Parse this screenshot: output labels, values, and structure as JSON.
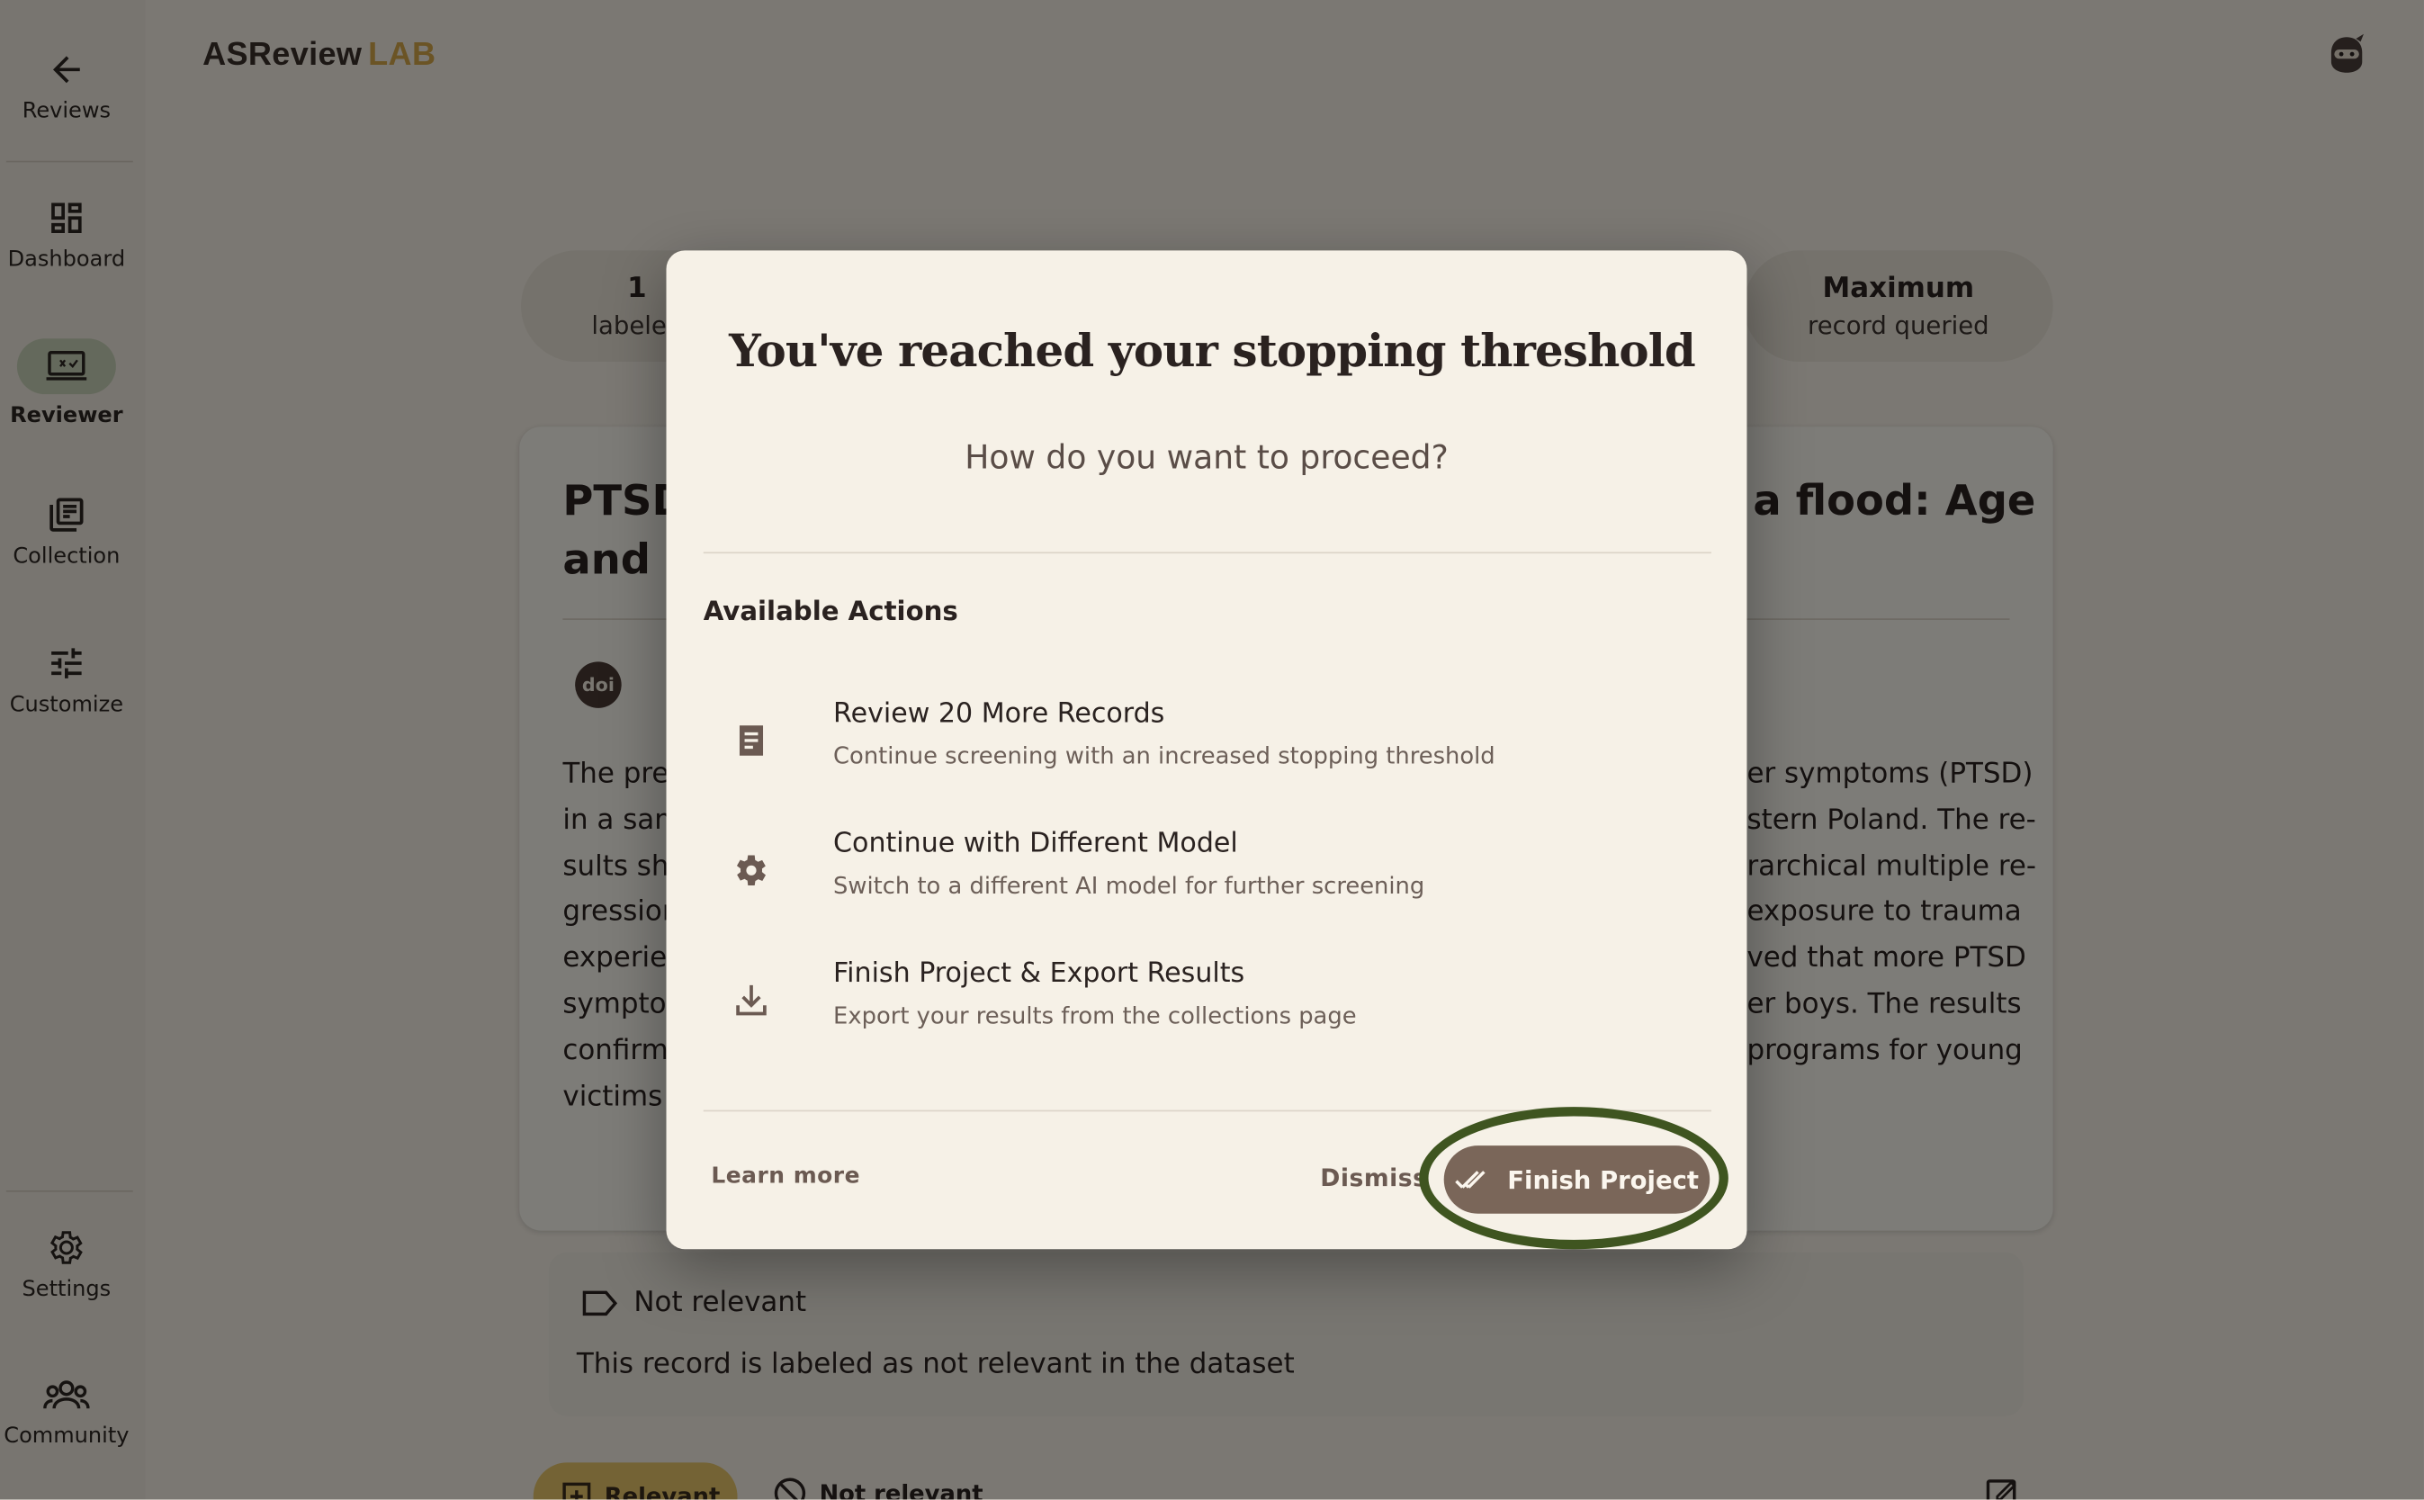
{
  "app": {
    "brand_main": "ASReview",
    "brand_accent": "LAB"
  },
  "sidebar": {
    "back": {
      "label": "Reviews",
      "icon": "arrow-back-icon"
    },
    "items": [
      {
        "label": "Dashboard",
        "icon": "dashboard-icon"
      },
      {
        "label": "Reviewer",
        "icon": "reviewer-icon",
        "active": true
      },
      {
        "label": "Collection",
        "icon": "collection-icon"
      },
      {
        "label": "Customize",
        "icon": "tune-icon"
      }
    ],
    "bottom": [
      {
        "label": "Settings",
        "icon": "gear-icon"
      },
      {
        "label": "Community",
        "icon": "community-icon"
      }
    ]
  },
  "stats": {
    "labeled_value": "1",
    "labeled_label": "labeled",
    "max_value": "Maximum",
    "max_label": "record queried"
  },
  "record": {
    "title_left_1": "PTSD",
    "title_left_2": "and g",
    "title_right": "a flood: Age",
    "doi_badge": "doi",
    "abstract_left": [
      "The pres",
      "in a sam",
      "sults sh",
      "gressior",
      "experien",
      "symptor",
      "confirm",
      "victims"
    ],
    "abstract_right": [
      "er symptoms (PTSD)",
      "stern Poland. The re-",
      "rarchical multiple re-",
      "exposure to trauma",
      "ved that more PTSD",
      "er boys. The results",
      "programs for young",
      ""
    ]
  },
  "label_panel": {
    "label": "Not relevant",
    "description": "This record is labeled as not relevant in the dataset"
  },
  "decision": {
    "relevant": "Relevant",
    "not_relevant": "Not relevant"
  },
  "dialog": {
    "title": "You've reached your stopping threshold",
    "subtitle": "How do you want to proceed?",
    "section": "Available Actions",
    "actions": [
      {
        "title": "Review 20 More Records",
        "desc": "Continue screening with an increased stopping threshold",
        "icon": "document-icon"
      },
      {
        "title": "Continue with Different Model",
        "desc": "Switch to a different AI model for further screening",
        "icon": "gear-icon"
      },
      {
        "title": "Finish Project & Export Results",
        "desc": "Export your results from the collections page",
        "icon": "download-icon"
      }
    ],
    "learn_more": "Learn more",
    "dismiss": "Dismiss",
    "finish": "Finish Project"
  },
  "colors": {
    "accent": "#d6a84a",
    "finish_button": "#7a6659",
    "highlight_ring": "#3f5520"
  }
}
